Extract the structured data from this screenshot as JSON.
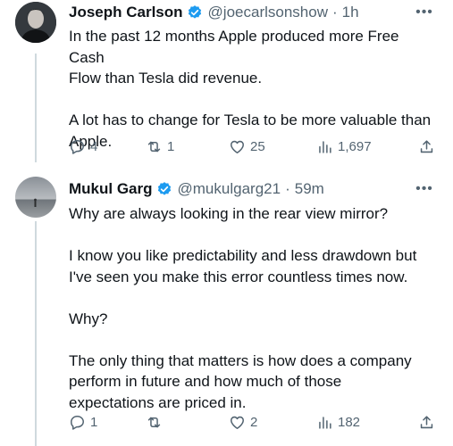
{
  "tweets": [
    {
      "name": "Joseph Carlson",
      "handle": "@joecarlsonshow",
      "dot": "·",
      "time": "1h",
      "text": [
        "In the past 12 months Apple produced more Free Cash",
        "Flow than Tesla did revenue.",
        "",
        "A lot has to change for Tesla to be more valuable than",
        "Apple."
      ],
      "replies": "4",
      "retweets": "1",
      "likes": "25",
      "views": "1,697"
    },
    {
      "name": "Mukul Garg",
      "handle": "@mukulgarg21",
      "dot": "·",
      "time": "59m",
      "text": [
        "Why are always looking in the rear view mirror?",
        "",
        "I know you like predictability and less drawdown but",
        "I've seen you make this error countless times now.",
        "",
        "Why?",
        "",
        "The only thing that matters is how does a company",
        "perform in future and how much of those",
        "expectations are priced in."
      ],
      "replies": "1",
      "retweets": "",
      "likes": "2",
      "views": "182"
    }
  ],
  "more_glyph": "•••",
  "colors": {
    "text": "#0f1419",
    "secondary": "#536471",
    "verified": "#1d9bf0"
  }
}
